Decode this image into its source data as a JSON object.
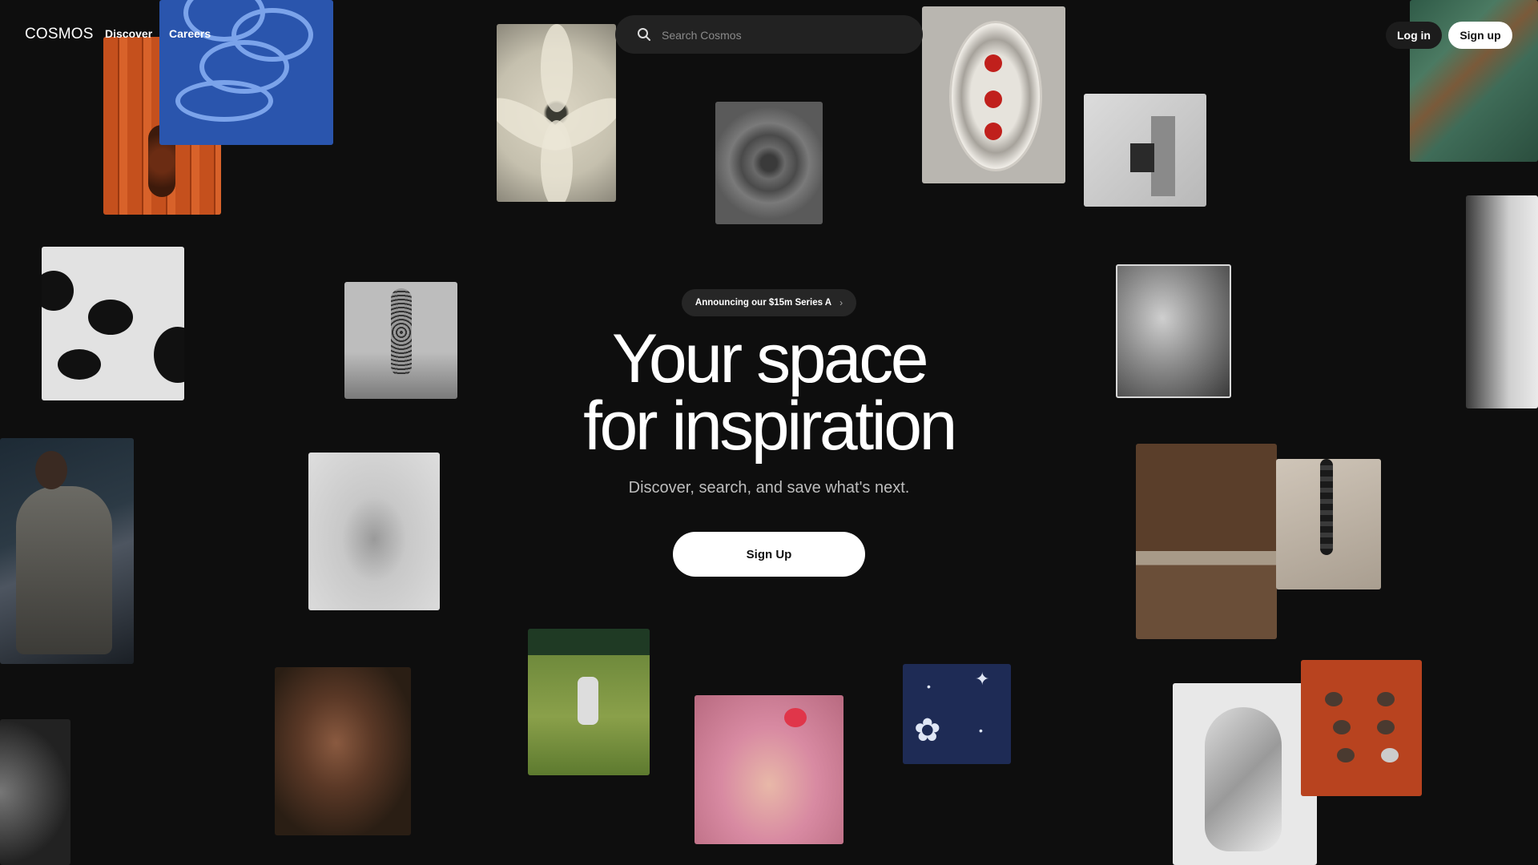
{
  "header": {
    "logo": "COSMOS",
    "nav": {
      "discover": "Discover",
      "careers": "Careers"
    },
    "search_placeholder": "Search Cosmos",
    "login_label": "Log in",
    "signup_label": "Sign up"
  },
  "hero": {
    "announcement": "Announcing our $15m Series A",
    "title_line1": "Your space",
    "title_line2": "for inspiration",
    "subtitle": "Discover, search, and save what's next.",
    "cta_label": "Sign Up"
  },
  "colors": {
    "background": "#0e0e0e",
    "pill_dark": "#262626",
    "cta_bg": "#ffffff"
  },
  "icons": {
    "search": "search-icon",
    "announce_chevron": "chevron-right-icon"
  }
}
